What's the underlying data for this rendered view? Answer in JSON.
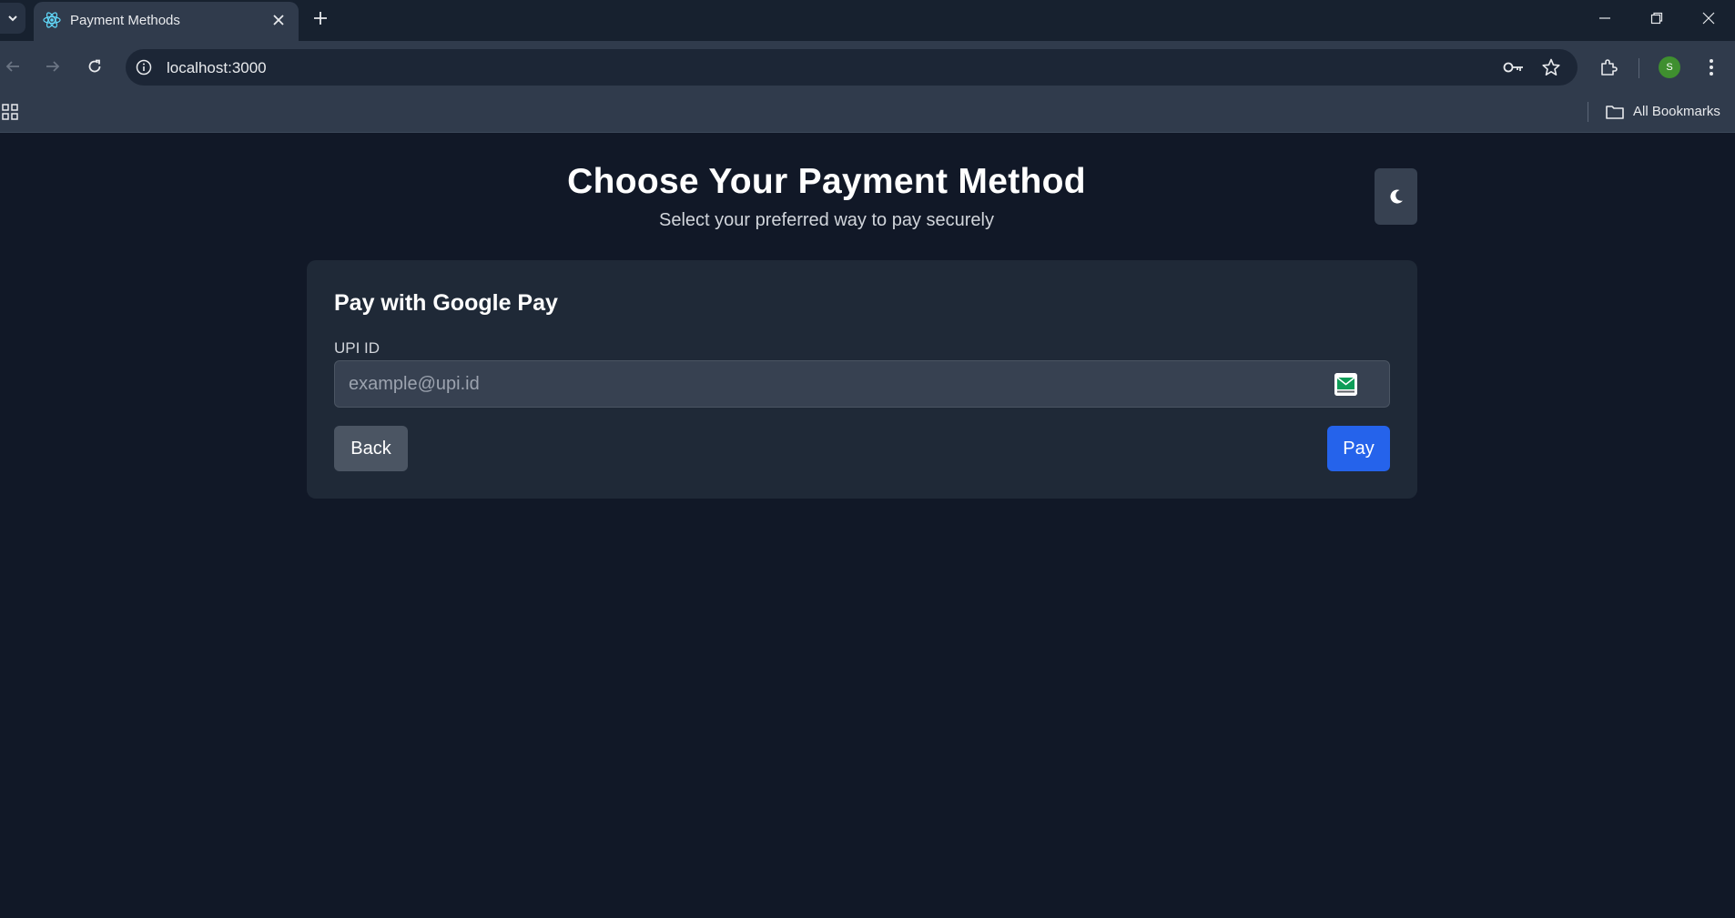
{
  "browser": {
    "tab": {
      "title": "Payment Methods",
      "favicon": "react-icon"
    },
    "address_bar": {
      "url": "localhost:3000"
    },
    "profile": {
      "initial": "S",
      "color": "#3f8f2f"
    },
    "bookmarks_bar": {
      "all_bookmarks_label": "All Bookmarks"
    }
  },
  "page": {
    "title": "Choose Your Payment Method",
    "subtitle": "Select your preferred way to pay securely",
    "theme_toggle_icon": "moon-icon"
  },
  "card": {
    "title": "Pay with Google Pay",
    "upi_field": {
      "label": "UPI ID",
      "placeholder": "example@upi.id",
      "value": ""
    },
    "buttons": {
      "back_label": "Back",
      "pay_label": "Pay"
    }
  },
  "colors": {
    "page_background": "#111827",
    "card_background": "#1f2937",
    "primary_button": "#2563eb",
    "secondary_button": "#4b5563"
  }
}
